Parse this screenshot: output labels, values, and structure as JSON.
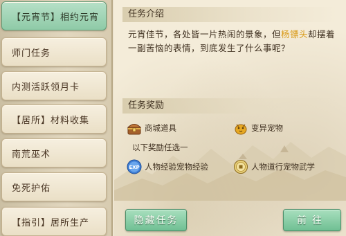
{
  "quest_list": {
    "items": [
      {
        "label": "【元宵节】相约元宵",
        "active": true
      },
      {
        "label": "师门任务"
      },
      {
        "label": "内测活跃领月卡"
      },
      {
        "label": "【居所】材料收集"
      },
      {
        "label": "南荒巫术"
      },
      {
        "label": "免死护佑"
      },
      {
        "label": "【指引】居所生产"
      }
    ]
  },
  "intro": {
    "heading": "任务介绍",
    "text_before": "元宵佳节，各处皆一片热闹的景象，但",
    "npc_name": "杨镖头",
    "text_after": "却摆着一副苦恼的表情，到底发生了什么事呢？",
    "highlight_color": "#d99a17"
  },
  "rewards": {
    "heading": "任务奖励",
    "fixed": [
      {
        "label": "商城道具",
        "icon": "treasure-chest-icon"
      },
      {
        "label": "变异宠物",
        "icon": "golden-pet-icon"
      }
    ],
    "choose_label": "以下奖励任选一",
    "choices": [
      {
        "label": "人物经验宠物经验",
        "icon": "exp-icon"
      },
      {
        "label": "人物道行宠物武学",
        "icon": "coin-icon"
      }
    ]
  },
  "buttons": {
    "hide_label": "隐藏任务",
    "go_label": "前往"
  },
  "colors": {
    "accent_green": "#8fcaa7",
    "parchment": "#f4ecd9"
  }
}
